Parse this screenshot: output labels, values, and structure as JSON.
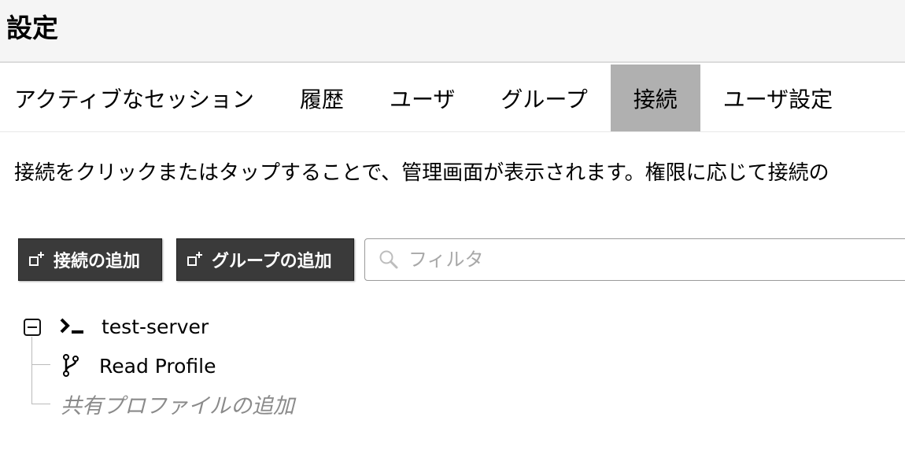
{
  "header": {
    "title": "設定"
  },
  "tabs": [
    {
      "label": "アクティブなセッション",
      "active": false
    },
    {
      "label": "履歴",
      "active": false
    },
    {
      "label": "ユーザ",
      "active": false
    },
    {
      "label": "グループ",
      "active": false
    },
    {
      "label": "接続",
      "active": true
    },
    {
      "label": "ユーザ設定",
      "active": false
    }
  ],
  "main": {
    "description": "接続をクリックまたはタップすることで、管理画面が表示されます。権限に応じて接続の",
    "add_connection_label": "接続の追加",
    "add_group_label": "グループの追加",
    "filter": {
      "placeholder": "フィルタ",
      "value": ""
    },
    "tree": {
      "connection_name": "test-server",
      "connection_icon": "terminal-icon",
      "profile_name": "Read Profile",
      "profile_icon": "branch-icon",
      "add_profile_label": "共有プロファイルの追加"
    }
  },
  "colors": {
    "header_bg": "#f5f5f5",
    "active_tab_bg": "#b0b0b0",
    "button_bg": "#3a3a3a",
    "muted_text": "#8a8a8a"
  }
}
